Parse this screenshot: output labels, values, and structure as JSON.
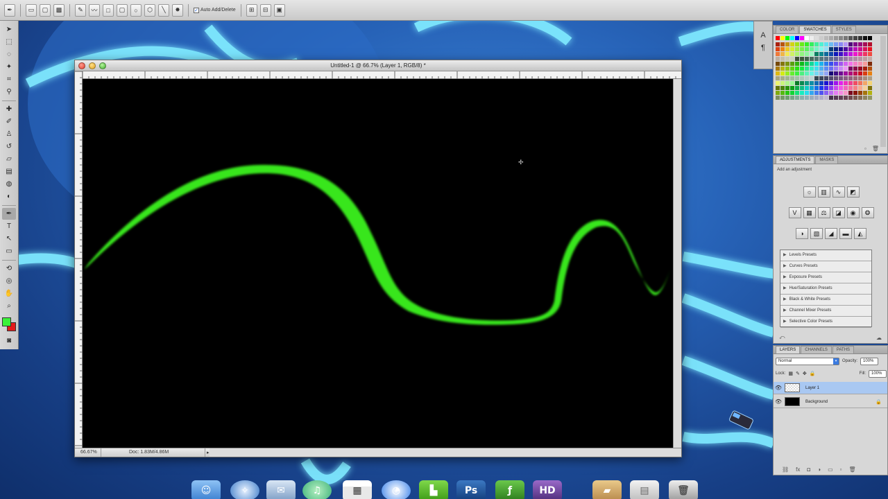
{
  "options_bar": {
    "auto_add_delete_label": "Auto Add/Delete"
  },
  "document": {
    "title": "Untitled-1 @ 66.7% (Layer 1, RGB/8) *",
    "zoom": "66.67%",
    "doc_size": "Doc: 1.83M/4.86M"
  },
  "swatches_panel": {
    "tabs": [
      "COLOR",
      "SWATCHES",
      "STYLES"
    ],
    "active_tab": 1
  },
  "adjustments_panel": {
    "tabs": [
      "ADJUSTMENTS",
      "MASKS"
    ],
    "caption": "Add an adjustment",
    "presets": [
      "Levels Presets",
      "Curves Presets",
      "Exposure Presets",
      "Hue/Saturation Presets",
      "Black & White Presets",
      "Channel Mixer Presets",
      "Selective Color Presets"
    ]
  },
  "layers_panel": {
    "tabs": [
      "LAYERS",
      "CHANNELS",
      "PATHS"
    ],
    "blend_mode": "Normal",
    "opacity_label": "Opacity:",
    "opacity_value": "100%",
    "lock_label": "Lock:",
    "fill_label": "Fill:",
    "fill_value": "100%",
    "layers": [
      {
        "name": "Layer 1",
        "selected": true
      },
      {
        "name": "Background",
        "selected": false
      }
    ]
  },
  "icons": {
    "fg_color": "#3cf23a",
    "bg_color": "#e31b1b",
    "stroke_color": "#39e61c"
  }
}
